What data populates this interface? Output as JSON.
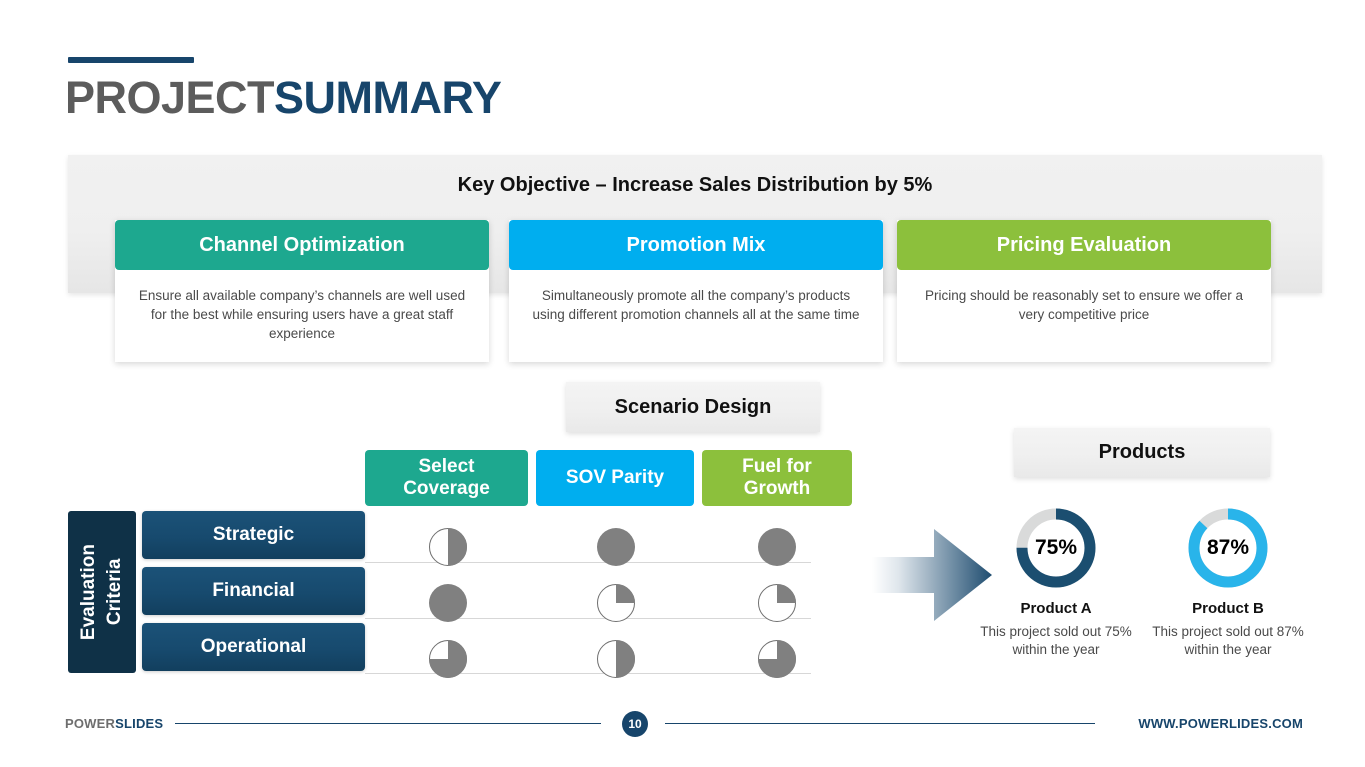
{
  "title": {
    "part1": "PROJECT",
    "part2": "SUMMARY"
  },
  "objective": {
    "heading": "Key Objective – Increase Sales Distribution by 5%"
  },
  "colors": {
    "teal": "#1da88f",
    "cyan": "#00aeef",
    "green": "#8cc03c",
    "navy": "#17456b",
    "navy_dark": "#0f3147",
    "ball_gray": "#808080",
    "track_gray": "#d9dada"
  },
  "cards": [
    {
      "title": "Channel Optimization",
      "color": "#1da88f",
      "body": "Ensure all available company’s channels are well used for the best while ensuring users have a great staff experience"
    },
    {
      "title": "Promotion Mix",
      "color": "#00aeef",
      "body": "Simultaneously promote all the company’s products using different promotion channels all at the same time"
    },
    {
      "title": "Pricing Evaluation",
      "color": "#8cc03c",
      "body": "Pricing should be reasonably set to ensure we offer a very competitive price"
    }
  ],
  "scenario": {
    "chip_label": "Scenario Design",
    "axis_label": "Evaluation\nCriteria",
    "columns": [
      {
        "label": "Select Coverage",
        "color": "#1da88f"
      },
      {
        "label": "SOV Parity",
        "color": "#00aeef"
      },
      {
        "label": "Fuel for Growth",
        "color": "#8cc03c"
      }
    ],
    "rows": [
      {
        "label": "Strategic",
        "values": [
          50,
          100,
          100
        ]
      },
      {
        "label": "Financial",
        "values": [
          100,
          25,
          25
        ]
      },
      {
        "label": "Operational",
        "values": [
          75,
          50,
          75
        ]
      }
    ]
  },
  "products": {
    "chip_label": "Products",
    "items": [
      {
        "name": "Product A",
        "percent": 75,
        "percent_label": "75%",
        "color": "#1b4e70",
        "desc": "This project sold out 75% within the year"
      },
      {
        "name": "Product B",
        "percent": 87,
        "percent_label": "87%",
        "color": "#29b4ea",
        "desc": "This project sold out 87% within the year"
      }
    ]
  },
  "footer": {
    "brand1": "POWER",
    "brand2": "SLIDES",
    "page_number": "10",
    "url": "WWW.POWERLIDES.COM"
  }
}
